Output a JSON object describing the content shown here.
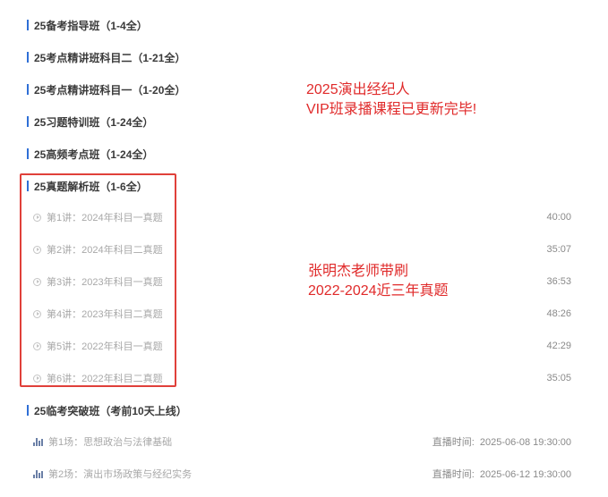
{
  "sections": [
    {
      "title": "25备考指导班（1-4全）"
    },
    {
      "title": "25考点精讲班科目二（1-21全）"
    },
    {
      "title": "25考点精讲班科目一（1-20全）"
    },
    {
      "title": "25习题特训班（1-24全）"
    },
    {
      "title": "25高频考点班（1-24全）"
    },
    {
      "title": "25真题解析班（1-6全）"
    },
    {
      "title": "25临考突破班（考前10天上线）"
    }
  ],
  "lessons": [
    {
      "title": "第1讲：2024年科目一真题",
      "duration": "40:00"
    },
    {
      "title": "第2讲：2024年科目二真题",
      "duration": "35:07"
    },
    {
      "title": "第3讲：2023年科目一真题",
      "duration": "36:53"
    },
    {
      "title": "第4讲：2023年科目二真题",
      "duration": "48:26"
    },
    {
      "title": "第5讲：2022年科目一真题",
      "duration": "42:29"
    },
    {
      "title": "第6讲：2022年科目二真题",
      "duration": "35:05"
    }
  ],
  "live_sessions": [
    {
      "title": "第1场：思想政治与法律基础",
      "time_label": "直播时间:",
      "time": "2025-06-08 19:30:00"
    },
    {
      "title": "第2场：演出市场政策与经纪实务",
      "time_label": "直播时间:",
      "time": "2025-06-12 19:30:00"
    }
  ],
  "annotations": {
    "top": [
      "2025演出经纪人",
      "VIP班录播课程已更新完毕!"
    ],
    "middle": [
      "张明杰老师带刷",
      "2022-2024近三年真题"
    ]
  },
  "colors": {
    "accent_bar": "#2f6fd6",
    "annotation_red": "#e02a2a",
    "box_red": "#e0403a"
  }
}
